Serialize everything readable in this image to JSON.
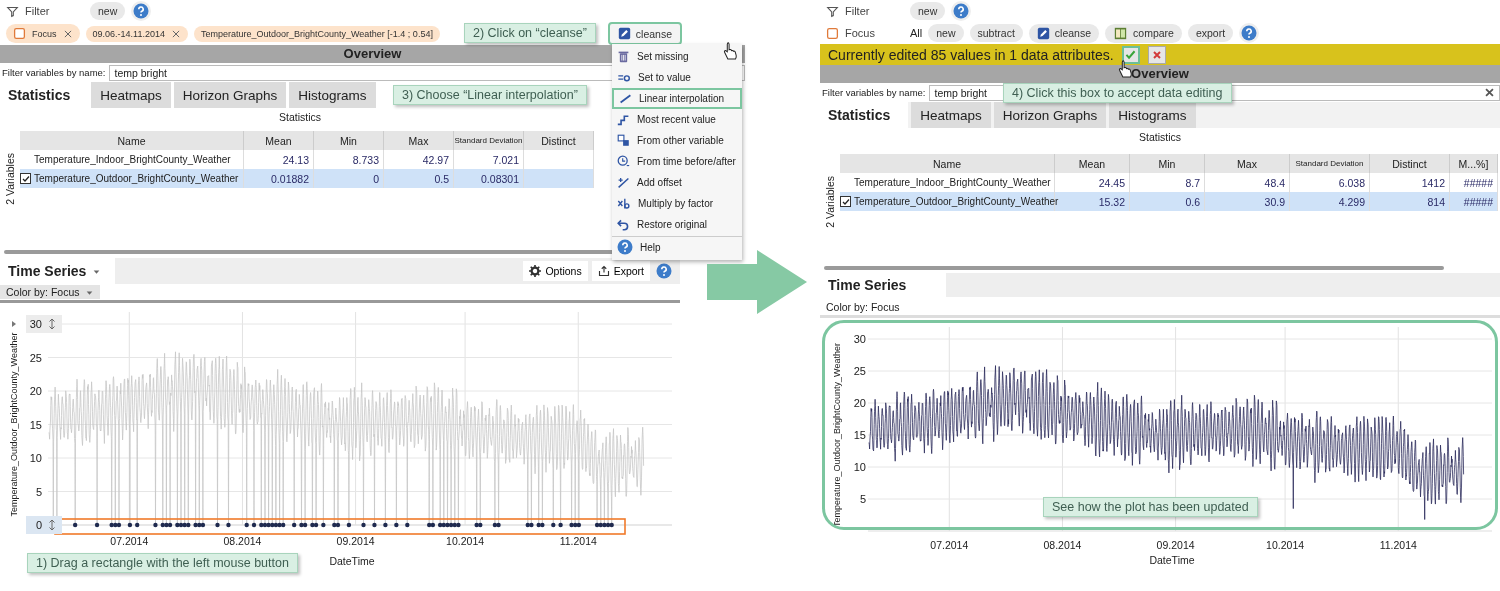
{
  "before": {
    "toolbar_rows": [
      {
        "items": [
          {
            "kind": "filter",
            "label": "Filter"
          },
          {
            "kind": "button",
            "label": "new"
          },
          {
            "kind": "help"
          }
        ]
      },
      {
        "items": [
          {
            "kind": "focus",
            "label": "Focus",
            "removable": true
          },
          {
            "kind": "chip",
            "label": "09.06.-14.11.2014",
            "removable": true
          },
          {
            "kind": "chip",
            "label": "Temperature_Outdoor_BrightCounty_Weather [-1.4 ; 0.54]",
            "removable": false
          },
          {
            "kind": "edit",
            "label": "cleanse",
            "highlighted": true
          }
        ]
      }
    ],
    "overview_title": "Overview",
    "filter_field": {
      "label": "Filter variables by name:",
      "value": "temp bright"
    },
    "tabs": [
      {
        "label": "Statistics",
        "selected": true
      },
      {
        "label": "Heatmaps",
        "selected": false
      },
      {
        "label": "Horizon Graphs",
        "selected": false
      },
      {
        "label": "Histograms",
        "selected": false
      }
    ],
    "table": {
      "caption": "Statistics",
      "side_label": "2 Variables",
      "columns": [
        "Name",
        "Mean",
        "Min",
        "Max",
        "Standard Deviation",
        "Distinct"
      ],
      "rows": [
        {
          "cells": [
            "Temperature_Indoor_BrightCounty_Weather",
            "24.13",
            "8.733",
            "42.97",
            "7.021"
          ],
          "selected": false,
          "checked": false
        },
        {
          "cells": [
            "Temperature_Outdoor_BrightCounty_Weather",
            "0.01882",
            "0",
            "0.5",
            "0.08301"
          ],
          "selected": true,
          "checked": true
        }
      ]
    },
    "time_series": {
      "title": "Time Series",
      "dropdown": true,
      "actions": [
        {
          "kind": "options",
          "label": "Options"
        },
        {
          "kind": "export",
          "label": "Export"
        },
        {
          "kind": "help"
        }
      ],
      "color_by": {
        "label": "Color by: Focus",
        "dropdown": true
      },
      "plot": {
        "ylabel": "Temperature_Outdoor_BrightCounty_Weather",
        "xlabel": "DateTime",
        "selection": true,
        "yticks": [
          {
            "label": "30",
            "handle": true
          },
          {
            "label": "25",
            "handle": false
          },
          {
            "label": "20",
            "handle": false
          },
          {
            "label": "15",
            "handle": false
          },
          {
            "label": "10",
            "handle": false
          },
          {
            "label": "5",
            "handle": false
          },
          {
            "label": "0",
            "handle": true
          }
        ],
        "xticks": [
          "07.2014",
          "08.2014",
          "09.2014",
          "10.2014",
          "11.2014"
        ]
      }
    },
    "cleanse_menu": {
      "items": [
        {
          "label": "Set missing",
          "highlighted": false
        },
        {
          "label": "Set to value",
          "highlighted": false
        },
        {
          "label": "Linear interpolation",
          "highlighted": true
        },
        {
          "label": "Most recent value",
          "highlighted": false
        },
        {
          "label": "From other variable",
          "highlighted": false
        },
        {
          "label": "From time before/after",
          "highlighted": false
        },
        {
          "label": "Add offset",
          "highlighted": false
        },
        {
          "label": "Multiply by factor",
          "highlighted": false
        },
        {
          "label": "Restore original",
          "highlighted": false
        },
        {
          "label": "Help",
          "highlighted": false
        }
      ]
    }
  },
  "after": {
    "toolbar_rows": [
      {
        "items": [
          {
            "kind": "filter",
            "label": "Filter"
          },
          {
            "kind": "button",
            "label": "new"
          },
          {
            "kind": "help"
          }
        ]
      },
      {
        "items": [
          {
            "kind": "focus",
            "label": "Focus",
            "removable": false
          },
          {
            "kind": "text",
            "label": "All"
          },
          {
            "kind": "button",
            "label": "new"
          },
          {
            "kind": "button",
            "label": "subtract"
          },
          {
            "kind": "edit",
            "label": "cleanse",
            "highlighted": false
          },
          {
            "kind": "compare",
            "label": "compare"
          },
          {
            "kind": "button",
            "label": "export"
          },
          {
            "kind": "help"
          }
        ]
      }
    ],
    "edit_bar": {
      "message": "Currently edited 85 values in 1 data attributes.",
      "accept_highlighted": true
    },
    "overview_title": "Overview",
    "filter_field": {
      "label": "Filter variables by name:",
      "value": "temp bright",
      "clearable": true
    },
    "tabs": [
      {
        "label": "Statistics",
        "selected": true
      },
      {
        "label": "Heatmaps",
        "selected": false
      },
      {
        "label": "Horizon Graphs",
        "selected": false
      },
      {
        "label": "Histograms",
        "selected": false
      }
    ],
    "table": {
      "caption": "Statistics",
      "side_label": "2 Variables",
      "columns": [
        "Name",
        "Mean",
        "Min",
        "Max",
        "Standard Deviation",
        "Distinct",
        "M...%]"
      ],
      "rows": [
        {
          "cells": [
            "Temperature_Indoor_BrightCounty_Weather",
            "24.45",
            "8.7",
            "48.4",
            "6.038",
            "1412",
            "#####"
          ],
          "selected": false,
          "checked": false
        },
        {
          "cells": [
            "Temperature_Outdoor_BrightCounty_Weather",
            "15.32",
            "0.6",
            "30.9",
            "4.299",
            "814",
            "#####"
          ],
          "selected": true,
          "checked": true
        }
      ]
    },
    "time_series": {
      "title": "Time Series",
      "dropdown": false,
      "color_by": {
        "label": "Color by: Focus",
        "dropdown": false
      },
      "plot": {
        "ylabel": "Temperature_Outdoor_BrightCounty_Weather",
        "xlabel": "DateTime",
        "highlighted": true,
        "yticks": [
          {
            "label": "30",
            "handle": false
          },
          {
            "label": "25",
            "handle": false
          },
          {
            "label": "20",
            "handle": false
          },
          {
            "label": "15",
            "handle": false
          },
          {
            "label": "10",
            "handle": false
          },
          {
            "label": "5",
            "handle": false
          }
        ],
        "xticks": [
          "07.2014",
          "08.2014",
          "09.2014",
          "10.2014",
          "11.2014"
        ]
      }
    }
  },
  "callouts": [
    {
      "text": "1) Drag a rectangle with the left mouse button"
    },
    {
      "text": "2) Click on “cleanse”"
    },
    {
      "text": "3) Choose “Linear interpolation”"
    },
    {
      "text": "4) Click this box to accept data editing"
    },
    {
      "text": "See how the plot has been updated"
    }
  ]
}
